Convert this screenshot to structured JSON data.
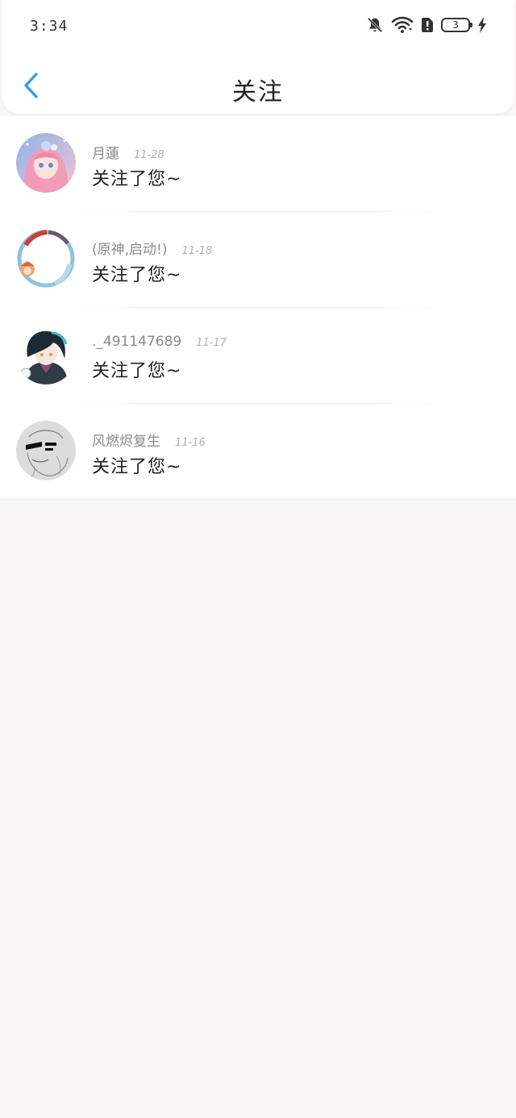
{
  "status_bar": {
    "time": "3:34",
    "battery": "3",
    "icons": [
      "bell-off-icon",
      "wifi-icon",
      "sim-alert-icon",
      "battery-icon",
      "charging-icon"
    ]
  },
  "header": {
    "title": "关注",
    "back_icon": "chevron-left-icon",
    "accent_color": "#3a9ae6"
  },
  "notifications": [
    {
      "name": "月蓮",
      "date": "11-28",
      "message": "关注了您~",
      "avatar": "pink-anime-avatar"
    },
    {
      "name": "(原神,启动!)",
      "date": "11-18",
      "message": "关注了您~",
      "avatar": "ring-frame-avatar"
    },
    {
      "name": "._491147689",
      "date": "11-17",
      "message": "关注了您~",
      "avatar": "dark-hair-anime-avatar"
    },
    {
      "name": "风燃烬复生",
      "date": "11-16",
      "message": "关注了您~",
      "avatar": "sketch-sunglasses-avatar"
    }
  ],
  "colors": {
    "background": "#f8f6f7",
    "card": "#ffffff",
    "text_primary": "#222222",
    "text_secondary": "#8a8a8a"
  }
}
